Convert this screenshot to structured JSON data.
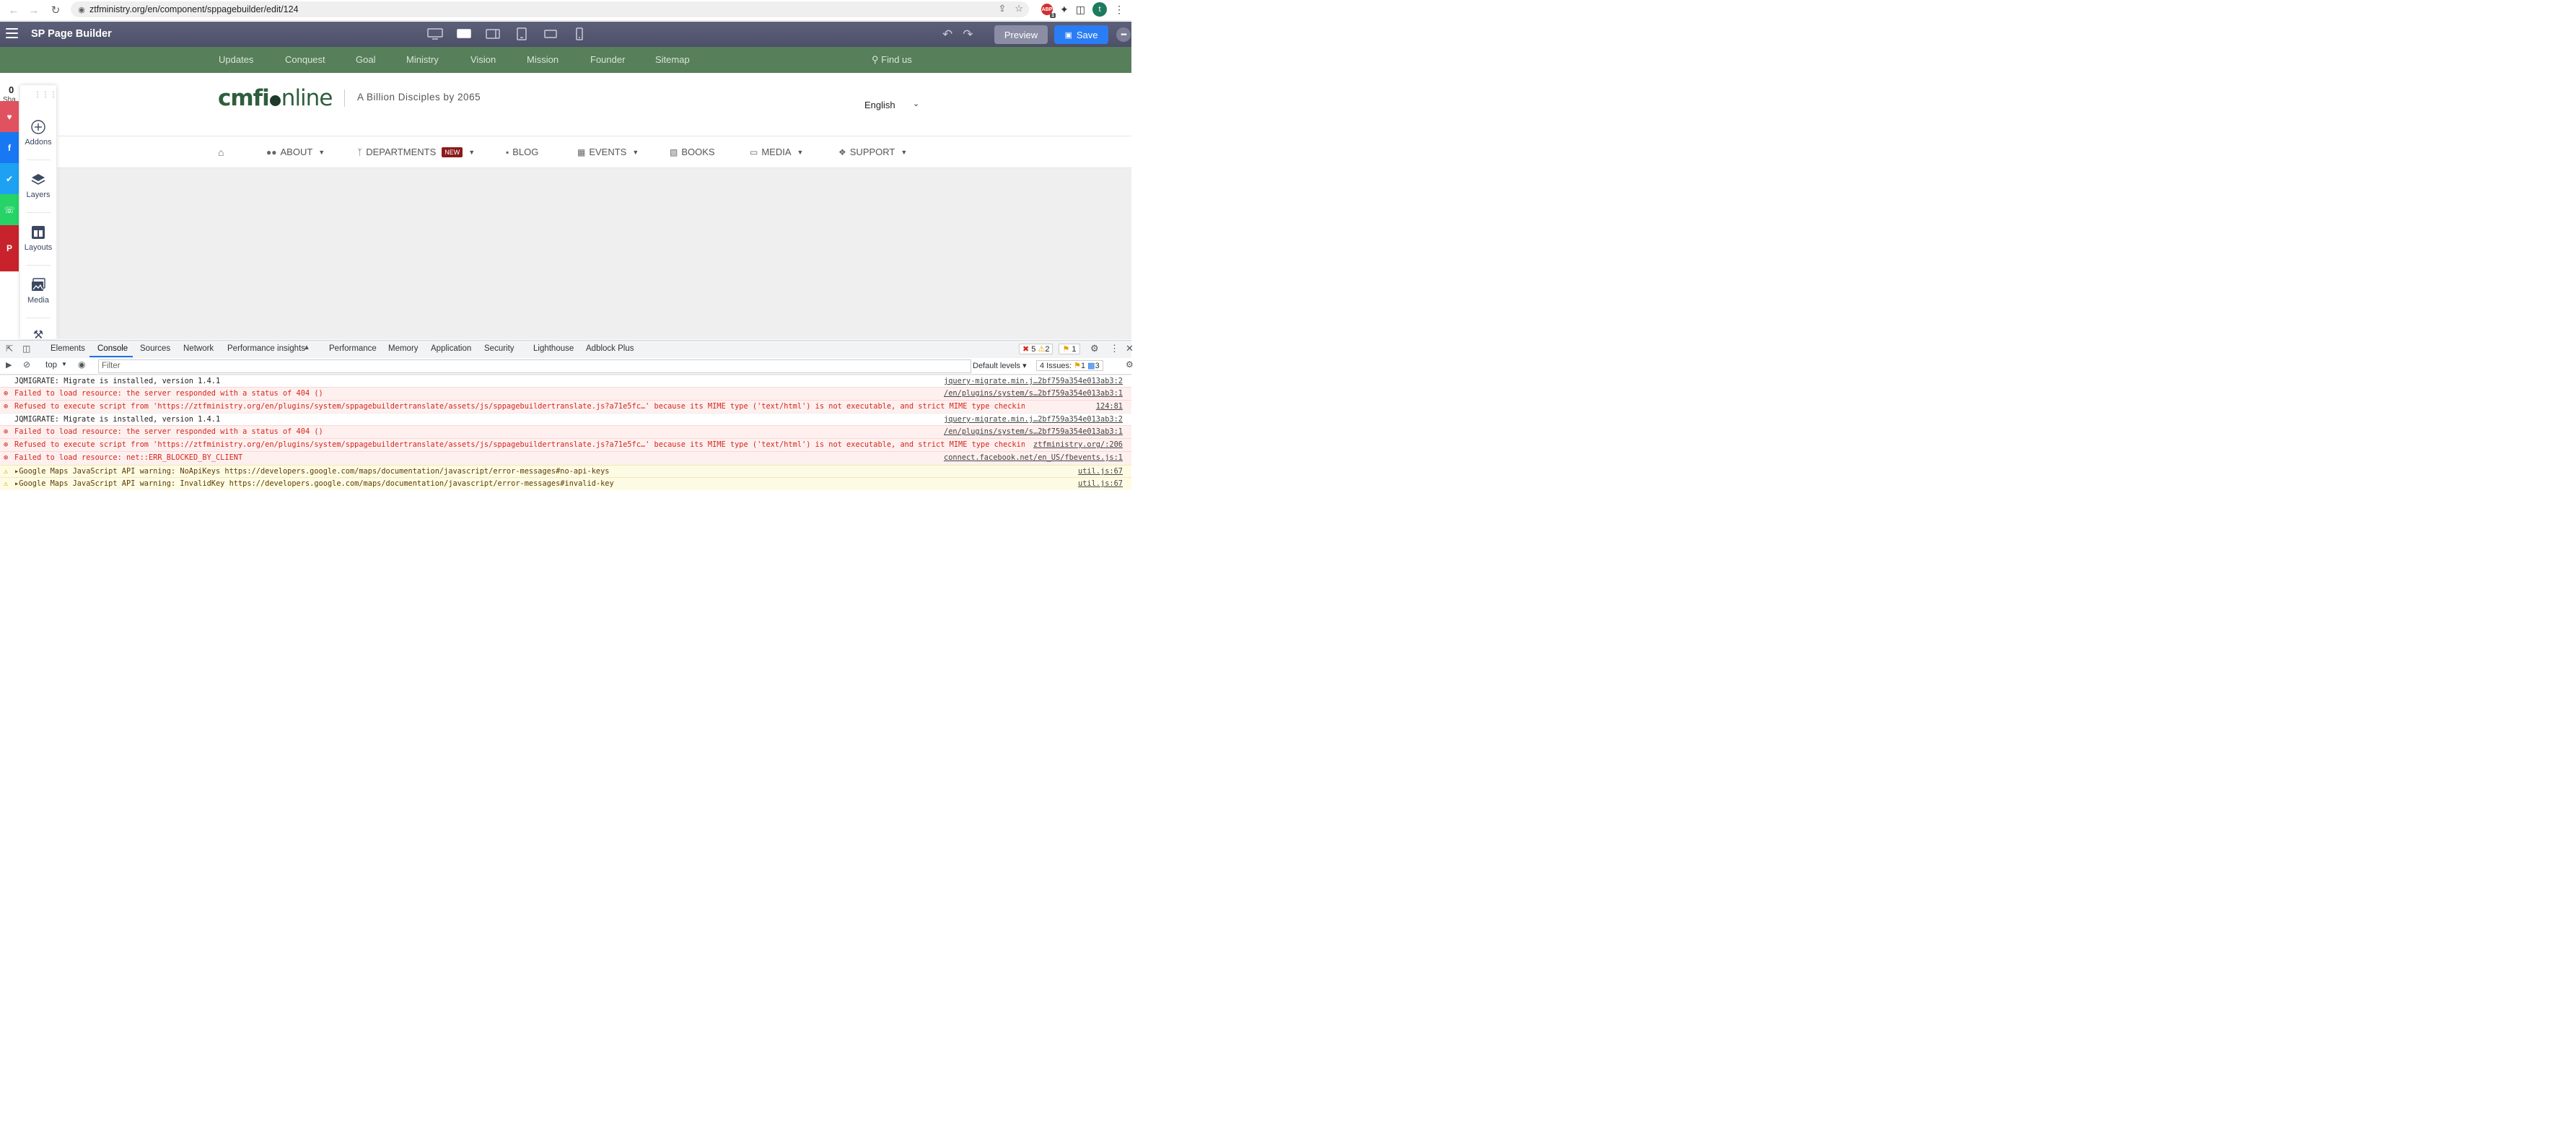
{
  "browser": {
    "url": "ztfministry.org/en/component/sppagebuilder/edit/124",
    "avatar_letter": "t",
    "ext_badge": "1"
  },
  "builder": {
    "brand": "SP Page Builder",
    "preview_label": "Preview",
    "save_label": "Save",
    "devices": [
      "desktop",
      "laptop",
      "tablet-landscape",
      "tablet",
      "mobile-landscape",
      "mobile"
    ]
  },
  "site": {
    "top_links": [
      "Updates",
      "Conquest",
      "Goal",
      "Ministry",
      "Vision",
      "Mission",
      "Founder",
      "Sitemap"
    ],
    "find_us": "Find us",
    "logo_left": "cmfi",
    "logo_right": "nline",
    "tagline": "A Billion Disciples by 2065",
    "language": "English",
    "menu": [
      {
        "label": "ABOUT"
      },
      {
        "label": "DEPARTMENTS",
        "badge": "NEW"
      },
      {
        "label": "BLOG"
      },
      {
        "label": "EVENTS"
      },
      {
        "label": "BOOKS"
      },
      {
        "label": "MEDIA"
      },
      {
        "label": "SUPPORT"
      }
    ]
  },
  "share": {
    "count": "0",
    "count2": "0",
    "label": "Sha"
  },
  "side_panel": {
    "items": [
      "Addons",
      "Layers",
      "Layouts",
      "Media"
    ]
  },
  "devtools": {
    "tabs": [
      "Elements",
      "Console",
      "Sources",
      "Network",
      "Performance insights",
      "Performance",
      "Memory",
      "Application",
      "Security",
      "Lighthouse",
      "Adblock Plus"
    ],
    "errors": "5",
    "warnings": "2",
    "info": "1",
    "context": "top",
    "filter_placeholder": "Filter",
    "levels": "Default levels",
    "issues_label": "4 Issues:",
    "issues_warn": "1",
    "issues_info": "3",
    "logs": [
      {
        "level": "info",
        "msg": "JQMIGRATE: Migrate is installed, version 1.4.1",
        "src": "jquery-migrate.min.j…2bf759a354e013ab3:2"
      },
      {
        "level": "err",
        "msg": "Failed to load resource: the server responded with a status of 404 ()",
        "src": "/en/plugins/system/s…2bf759a354e013ab3:1"
      },
      {
        "level": "err",
        "msg": "Refused to execute script from 'https://ztfministry.org/en/plugins/system/sppagebuildertranslate/assets/js/sppagebuildertranslate.js?a71e5fc…' because its MIME type ('text/html') is not executable, and strict MIME type checking is enabled.",
        "src": "124:81"
      },
      {
        "level": "info",
        "msg": "JQMIGRATE: Migrate is installed, version 1.4.1",
        "src": "jquery-migrate.min.j…2bf759a354e013ab3:2"
      },
      {
        "level": "err",
        "msg": "Failed to load resource: the server responded with a status of 404 ()",
        "src": "/en/plugins/system/s…2bf759a354e013ab3:1"
      },
      {
        "level": "err",
        "msg": "Refused to execute script from 'https://ztfministry.org/en/plugins/system/sppagebuildertranslate/assets/js/sppagebuildertranslate.js?a71e5fc…' because its MIME type ('text/html') is not executable, and strict MIME type checking is enabled.",
        "src": "ztfministry.org/:206"
      },
      {
        "level": "err",
        "msg": "Failed to load resource: net::ERR_BLOCKED_BY_CLIENT",
        "src": "connect.facebook.net/en_US/fbevents.js:1"
      },
      {
        "level": "warn",
        "msg": "▸Google Maps JavaScript API warning: NoApiKeys https://developers.google.com/maps/documentation/javascript/error-messages#no-api-keys",
        "src": "util.js:67"
      },
      {
        "level": "warn",
        "msg": "▸Google Maps JavaScript API warning: InvalidKey https://developers.google.com/maps/documentation/javascript/error-messages#invalid-key",
        "src": "util.js:67"
      }
    ]
  }
}
